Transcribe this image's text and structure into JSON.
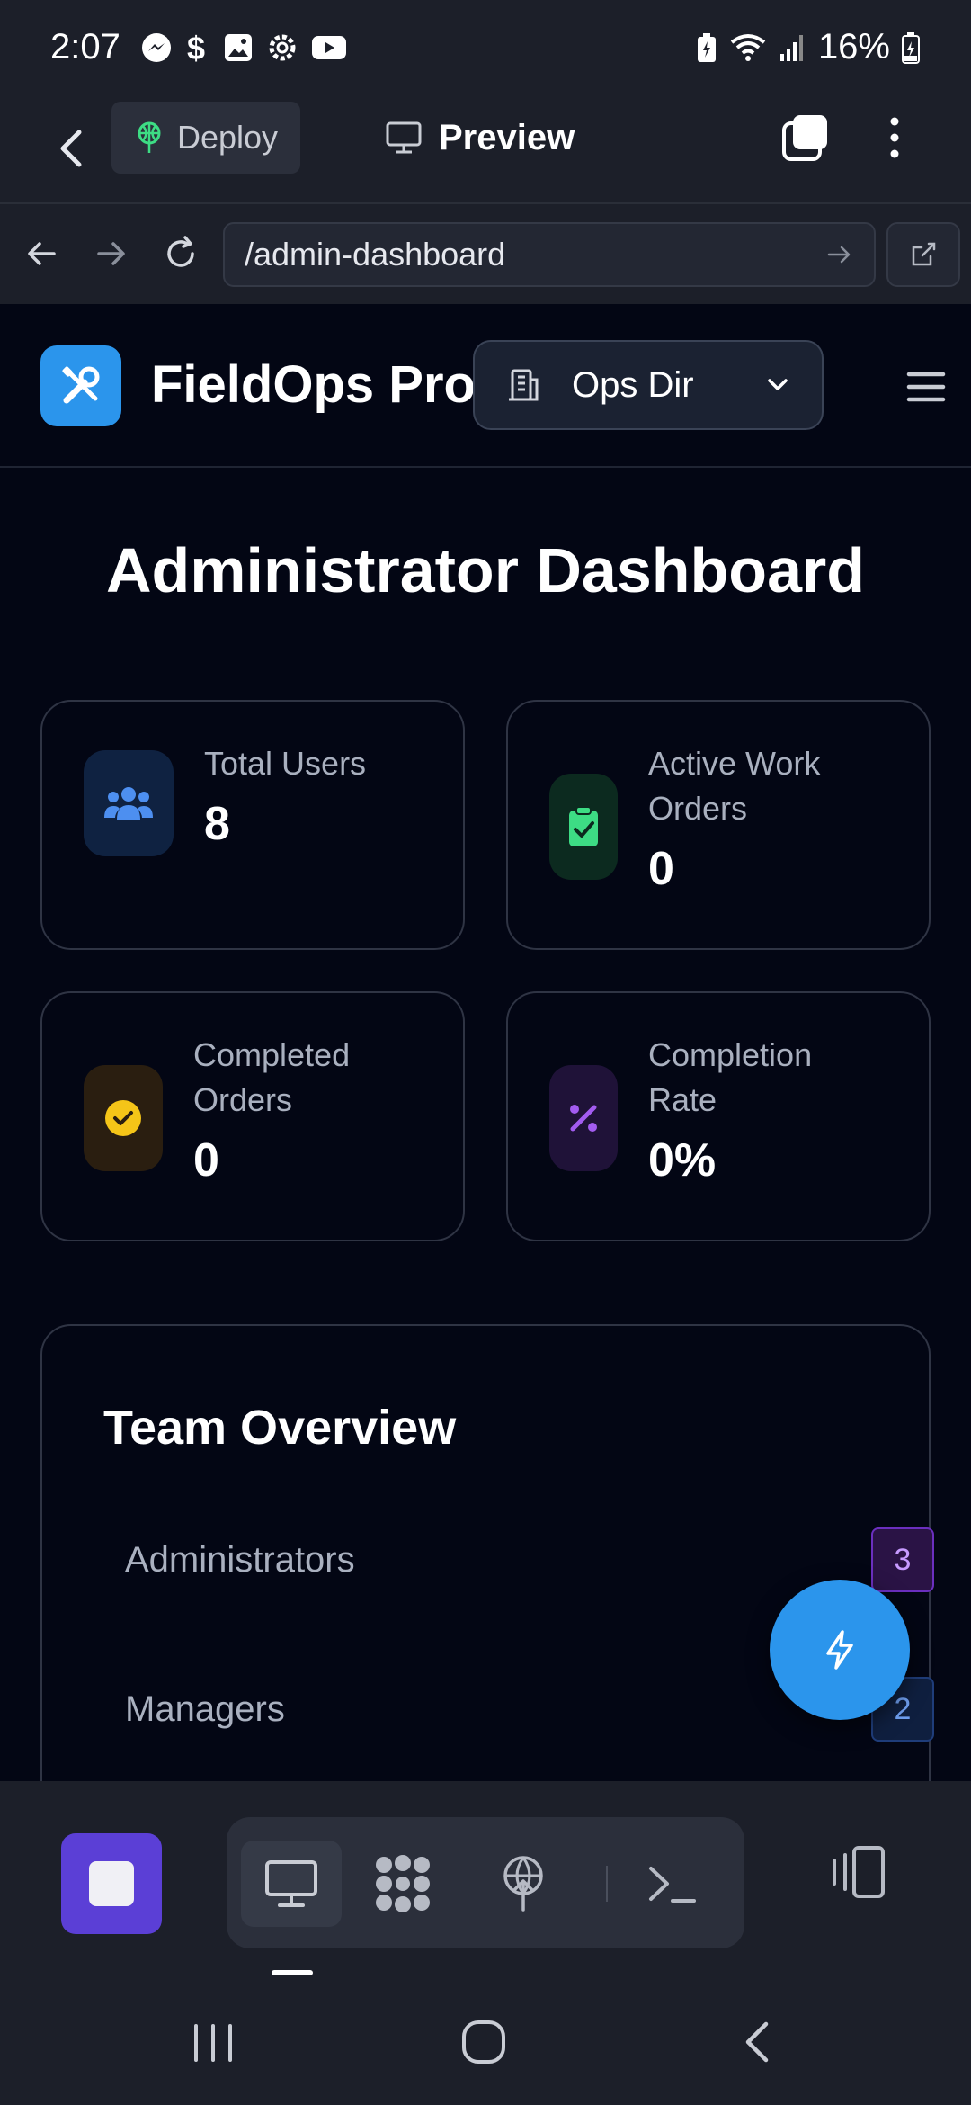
{
  "status_bar": {
    "time": "2:07",
    "battery": "16%",
    "left_icons": [
      "messenger-icon",
      "dollar-icon",
      "gallery-icon",
      "settings-icon",
      "youtube-icon"
    ],
    "right_icons": [
      "battery-saver-icon",
      "wifi-icon",
      "signal-icon",
      "battery-icon"
    ]
  },
  "replit_bar": {
    "deploy_label": "Deploy",
    "preview_label": "Preview"
  },
  "browser": {
    "url": "/admin-dashboard"
  },
  "app": {
    "name": "FieldOps Pro",
    "role_selector": "Ops Dir",
    "accent": "#2b95ec"
  },
  "dashboard": {
    "title": "Administrator Dashboard",
    "stats": [
      {
        "label": "Total Users",
        "value": "8",
        "icon": "users-icon",
        "color": "#4d8ff0"
      },
      {
        "label": "Active Work Orders",
        "value": "0",
        "icon": "clipboard-check-icon",
        "color": "#3ddc84"
      },
      {
        "label": "Completed Orders",
        "value": "0",
        "icon": "check-circle-icon",
        "color": "#f5c518"
      },
      {
        "label": "Completion Rate",
        "value": "0%",
        "icon": "percent-icon",
        "color": "#a35cf0"
      }
    ],
    "team_overview": {
      "title": "Team Overview",
      "rows": [
        {
          "label": "Administrators",
          "count": "3"
        },
        {
          "label": "Managers",
          "count": "2"
        }
      ]
    }
  }
}
